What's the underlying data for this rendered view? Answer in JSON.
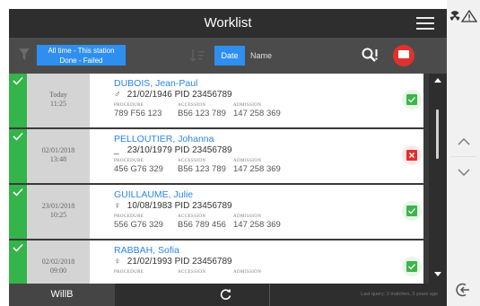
{
  "header": {
    "title": "Worklist"
  },
  "toolbar": {
    "filter_line1": "All time - This station",
    "filter_line2": "Done - Failed",
    "sort_date_label": "Date",
    "sort_name_label": "Name"
  },
  "labels": {
    "procedure": "PROCEDURE",
    "accession": "ACCESSION",
    "admission": "ADMISSION"
  },
  "rows": [
    {
      "date_line1": "Today",
      "date_line2": "11:25",
      "name": "DUBOIS, Jean-Paul",
      "sex_icon": "male-icon",
      "dob": "21/02/1946",
      "pid": "PID 23456789",
      "procedure": "789 F56 123",
      "accession": "B56 123 789",
      "admission": "147 258 369",
      "status": "done"
    },
    {
      "date_line1": "02/01/2018",
      "date_line2": "13:48",
      "name": "PELLOUTIER, Johanna",
      "sex_icon": "unknown-sex-icon",
      "dob": "23/10/1979",
      "pid": "PID 23456789",
      "procedure": "456 G76 329",
      "accession": "B56 123 789",
      "admission": "147 258 369",
      "status": "failed"
    },
    {
      "date_line1": "23/01/2018",
      "date_line2": "10:25",
      "name": "GUILLAUME, Julie",
      "sex_icon": "female-icon",
      "dob": "10/08/1983",
      "pid": "PID 23456789",
      "procedure": "556 G76 329",
      "accession": "B56 789 456",
      "admission": "147 258 369",
      "status": "done"
    },
    {
      "date_line1": "02/02/2018",
      "date_line2": "09:00",
      "name": "RABBAH, Sofia",
      "sex_icon": "female-icon",
      "dob": "21/02/1993",
      "pid": "PID 23456789",
      "procedure": "",
      "accession": "",
      "admission": "",
      "status": "done"
    }
  ],
  "footer": {
    "user": "WillB",
    "status_text": "Last query: 2 matches, 3 years ago"
  },
  "colors": {
    "accent": "#2f8ff0",
    "done": "#34b44a",
    "failed": "#e0312f",
    "link": "#2b86e6"
  }
}
